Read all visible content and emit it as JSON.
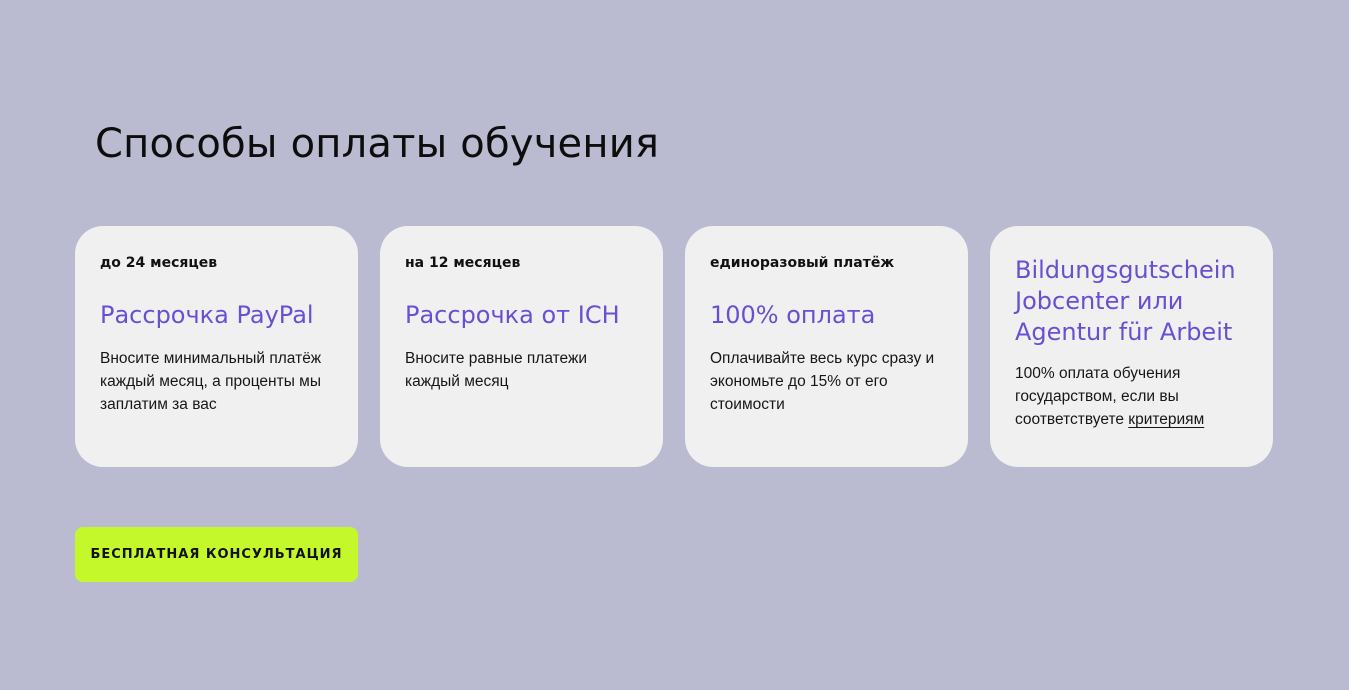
{
  "section": {
    "title": "Способы оплаты обучения"
  },
  "cards": [
    {
      "tag": "до 24 месяцев",
      "title": "Рассрочка PayPal",
      "description": "Вносите минимальный платёж каждый месяц, а проценты мы заплатим за вас"
    },
    {
      "tag": "на 12 месяцев",
      "title": "Рассрочка от ICH",
      "description": "Вносите равные платежи каждый месяц"
    },
    {
      "tag": "единоразовый платёж",
      "title": "100% оплата",
      "description": "Оплачивайте весь курс сразу и экономьте до 15% от его стоимости"
    },
    {
      "title_lines": [
        "Bildungsgutschein",
        "Jobcenter или",
        "Agentur für Arbeit"
      ],
      "description": "100% оплата обучения государством, если вы соответствуете",
      "link_label": "критериям"
    }
  ],
  "cta": {
    "label": "БЕСПЛАТНАЯ КОНСУЛЬТАЦИЯ"
  },
  "colors": {
    "background": "#babbd1",
    "card_background": "#f0f0f0",
    "accent_text": "#6a4fd2",
    "cta_background": "#c5f82a"
  }
}
